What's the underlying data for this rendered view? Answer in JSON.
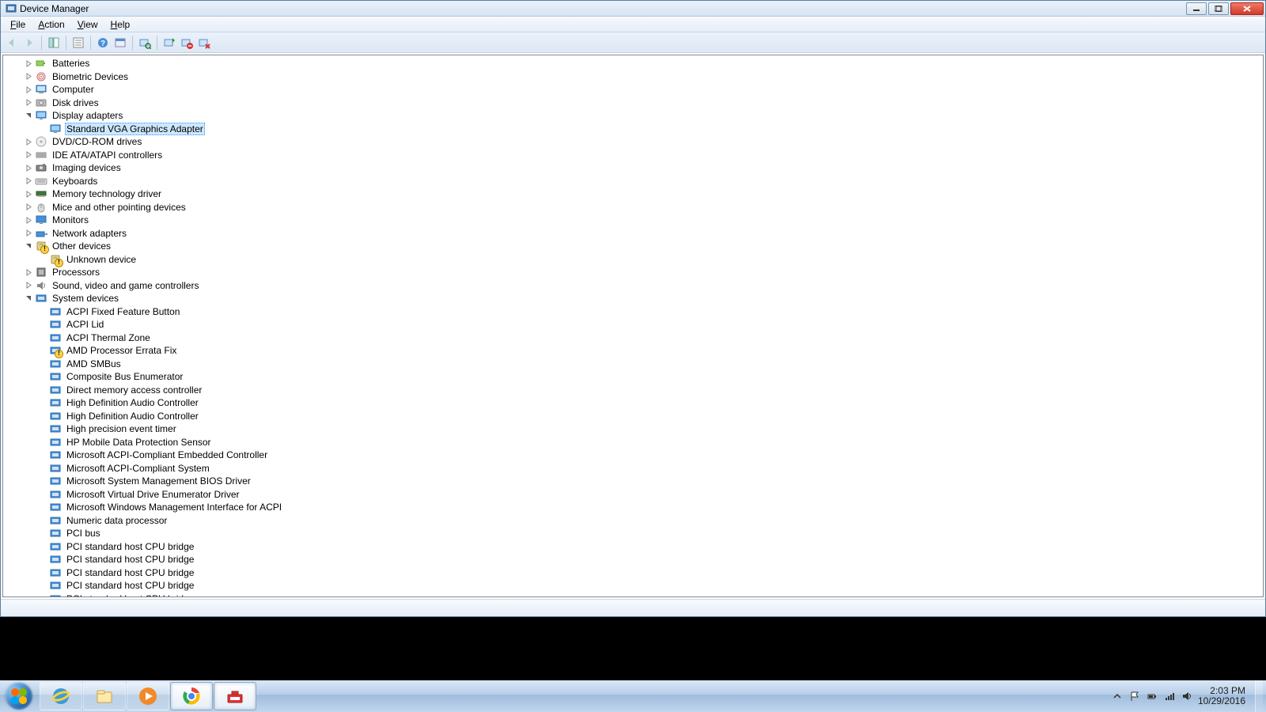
{
  "window": {
    "title": "Device Manager"
  },
  "menu": {
    "file": "File",
    "action": "Action",
    "view": "View",
    "help": "Help"
  },
  "toolbar": {
    "back": "Back",
    "forward": "Forward",
    "show_hide_console": "Show/Hide Console Tree",
    "properties": "Properties",
    "help": "Help",
    "action_menu": "Action",
    "scan": "Scan for hardware changes",
    "update": "Update Driver Software",
    "disable": "Disable",
    "uninstall": "Uninstall"
  },
  "status": "",
  "tree": [
    {
      "label": "Batteries",
      "depth": 1,
      "expand": "closed",
      "icon": "battery"
    },
    {
      "label": "Biometric Devices",
      "depth": 1,
      "expand": "closed",
      "icon": "biometric"
    },
    {
      "label": "Computer",
      "depth": 1,
      "expand": "closed",
      "icon": "computer"
    },
    {
      "label": "Disk drives",
      "depth": 1,
      "expand": "closed",
      "icon": "disk"
    },
    {
      "label": "Display adapters",
      "depth": 1,
      "expand": "open",
      "icon": "display"
    },
    {
      "label": "Standard VGA Graphics Adapter",
      "depth": 2,
      "expand": "none",
      "icon": "display",
      "selected": true
    },
    {
      "label": "DVD/CD-ROM drives",
      "depth": 1,
      "expand": "closed",
      "icon": "optical"
    },
    {
      "label": "IDE ATA/ATAPI controllers",
      "depth": 1,
      "expand": "closed",
      "icon": "ide"
    },
    {
      "label": "Imaging devices",
      "depth": 1,
      "expand": "closed",
      "icon": "imaging"
    },
    {
      "label": "Keyboards",
      "depth": 1,
      "expand": "closed",
      "icon": "keyboard"
    },
    {
      "label": "Memory technology driver",
      "depth": 1,
      "expand": "closed",
      "icon": "memory"
    },
    {
      "label": "Mice and other pointing devices",
      "depth": 1,
      "expand": "closed",
      "icon": "mouse"
    },
    {
      "label": "Monitors",
      "depth": 1,
      "expand": "closed",
      "icon": "monitor"
    },
    {
      "label": "Network adapters",
      "depth": 1,
      "expand": "closed",
      "icon": "network"
    },
    {
      "label": "Other devices",
      "depth": 1,
      "expand": "open",
      "icon": "other",
      "warn": true
    },
    {
      "label": "Unknown device",
      "depth": 2,
      "expand": "none",
      "icon": "other",
      "warn": true
    },
    {
      "label": "Processors",
      "depth": 1,
      "expand": "closed",
      "icon": "cpu"
    },
    {
      "label": "Sound, video and game controllers",
      "depth": 1,
      "expand": "closed",
      "icon": "sound"
    },
    {
      "label": "System devices",
      "depth": 1,
      "expand": "open",
      "icon": "system"
    },
    {
      "label": "ACPI Fixed Feature Button",
      "depth": 2,
      "expand": "none",
      "icon": "system"
    },
    {
      "label": "ACPI Lid",
      "depth": 2,
      "expand": "none",
      "icon": "system"
    },
    {
      "label": "ACPI Thermal Zone",
      "depth": 2,
      "expand": "none",
      "icon": "system"
    },
    {
      "label": "AMD Processor Errata Fix",
      "depth": 2,
      "expand": "none",
      "icon": "system",
      "warn": true
    },
    {
      "label": "AMD SMBus",
      "depth": 2,
      "expand": "none",
      "icon": "system"
    },
    {
      "label": "Composite Bus Enumerator",
      "depth": 2,
      "expand": "none",
      "icon": "system"
    },
    {
      "label": "Direct memory access controller",
      "depth": 2,
      "expand": "none",
      "icon": "system"
    },
    {
      "label": "High Definition Audio Controller",
      "depth": 2,
      "expand": "none",
      "icon": "system"
    },
    {
      "label": "High Definition Audio Controller",
      "depth": 2,
      "expand": "none",
      "icon": "system"
    },
    {
      "label": "High precision event timer",
      "depth": 2,
      "expand": "none",
      "icon": "system"
    },
    {
      "label": "HP Mobile Data Protection Sensor",
      "depth": 2,
      "expand": "none",
      "icon": "system"
    },
    {
      "label": "Microsoft ACPI-Compliant Embedded Controller",
      "depth": 2,
      "expand": "none",
      "icon": "system"
    },
    {
      "label": "Microsoft ACPI-Compliant System",
      "depth": 2,
      "expand": "none",
      "icon": "system"
    },
    {
      "label": "Microsoft System Management BIOS Driver",
      "depth": 2,
      "expand": "none",
      "icon": "system"
    },
    {
      "label": "Microsoft Virtual Drive Enumerator Driver",
      "depth": 2,
      "expand": "none",
      "icon": "system"
    },
    {
      "label": "Microsoft Windows Management Interface for ACPI",
      "depth": 2,
      "expand": "none",
      "icon": "system"
    },
    {
      "label": "Numeric data processor",
      "depth": 2,
      "expand": "none",
      "icon": "system"
    },
    {
      "label": "PCI bus",
      "depth": 2,
      "expand": "none",
      "icon": "system"
    },
    {
      "label": "PCI standard host CPU bridge",
      "depth": 2,
      "expand": "none",
      "icon": "system"
    },
    {
      "label": "PCI standard host CPU bridge",
      "depth": 2,
      "expand": "none",
      "icon": "system"
    },
    {
      "label": "PCI standard host CPU bridge",
      "depth": 2,
      "expand": "none",
      "icon": "system"
    },
    {
      "label": "PCI standard host CPU bridge",
      "depth": 2,
      "expand": "none",
      "icon": "system"
    },
    {
      "label": "PCI standard host CPU bridge",
      "depth": 2,
      "expand": "none",
      "icon": "system"
    }
  ],
  "taskbar": {
    "apps": [
      "ie",
      "explorer",
      "wmp",
      "chrome",
      "diagnostics"
    ],
    "active_index": 3,
    "tray_icons": [
      "chevron-up",
      "flag",
      "power",
      "network",
      "volume"
    ],
    "time": "2:03 PM",
    "date": "10/29/2016"
  }
}
